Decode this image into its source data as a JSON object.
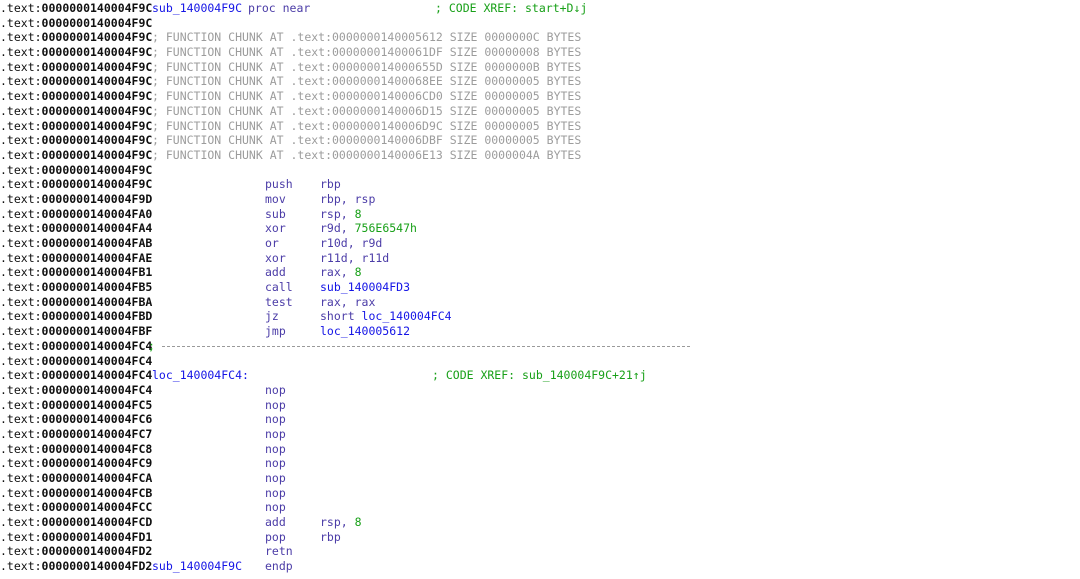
{
  "app": {
    "name": "IDA Pro disassembly listing",
    "view": "IDA View-A",
    "segment": "text",
    "background_color": "#ffffff"
  },
  "colors": {
    "address": "#101010",
    "name": "#1414e6",
    "keyword": "#4b3ca7",
    "mnemonic": "#4b3ca7",
    "operand_register": "#4b3ca7",
    "operand_number": "#18a018",
    "branch_target": "#1414e6",
    "comment": "#18a018",
    "comment_dim": "#9c9c9c",
    "separator": "#9a9a9a"
  },
  "function": {
    "name": "sub_140004F9C",
    "proc_keyword": "proc near",
    "endp_keyword": "endp",
    "start_address": "0000000140004F9C",
    "end_address": "0000000140004FD2",
    "xref_comment": "; CODE XREF: start+D↓j"
  },
  "chunks": [
    {
      "prefix": "; FUNCTION CHUNK AT",
      "seg": ".text:",
      "address": "0000000140005612",
      "size_label": "SIZE",
      "size": "0000000C",
      "unit": "BYTES"
    },
    {
      "prefix": "; FUNCTION CHUNK AT",
      "seg": ".text:",
      "address": "00000001400061DF",
      "size_label": "SIZE",
      "size": "00000008",
      "unit": "BYTES"
    },
    {
      "prefix": "; FUNCTION CHUNK AT",
      "seg": ".text:",
      "address": "000000014000655D",
      "size_label": "SIZE",
      "size": "0000000B",
      "unit": "BYTES"
    },
    {
      "prefix": "; FUNCTION CHUNK AT",
      "seg": ".text:",
      "address": "00000001400068EE",
      "size_label": "SIZE",
      "size": "00000005",
      "unit": "BYTES"
    },
    {
      "prefix": "; FUNCTION CHUNK AT",
      "seg": ".text:",
      "address": "0000000140006CD0",
      "size_label": "SIZE",
      "size": "00000005",
      "unit": "BYTES"
    },
    {
      "prefix": "; FUNCTION CHUNK AT",
      "seg": ".text:",
      "address": "0000000140006D15",
      "size_label": "SIZE",
      "size": "00000005",
      "unit": "BYTES"
    },
    {
      "prefix": "; FUNCTION CHUNK AT",
      "seg": ".text:",
      "address": "0000000140006D9C",
      "size_label": "SIZE",
      "size": "00000005",
      "unit": "BYTES"
    },
    {
      "prefix": "; FUNCTION CHUNK AT",
      "seg": ".text:",
      "address": "0000000140006DBF",
      "size_label": "SIZE",
      "size": "00000005",
      "unit": "BYTES"
    },
    {
      "prefix": "; FUNCTION CHUNK AT",
      "seg": ".text:",
      "address": "0000000140006E13",
      "size_label": "SIZE",
      "size": "0000004A",
      "unit": "BYTES"
    }
  ],
  "label": {
    "name": "loc_140004FC4:",
    "address": "0000000140004FC4",
    "xref_comment": "; CODE XREF: sub_140004F9C+21↑j"
  },
  "separator": {
    "semicolon": ";",
    "address": "0000000140004FC4"
  },
  "segment_prefix": ".text:",
  "lines": [
    {
      "kind": "proc",
      "addr": "0000000140004F9C"
    },
    {
      "kind": "blank",
      "addr": "0000000140004F9C"
    },
    {
      "kind": "chunk",
      "addr": "0000000140004F9C",
      "chunk": 0
    },
    {
      "kind": "chunk",
      "addr": "0000000140004F9C",
      "chunk": 1
    },
    {
      "kind": "chunk",
      "addr": "0000000140004F9C",
      "chunk": 2
    },
    {
      "kind": "chunk",
      "addr": "0000000140004F9C",
      "chunk": 3
    },
    {
      "kind": "chunk",
      "addr": "0000000140004F9C",
      "chunk": 4
    },
    {
      "kind": "chunk",
      "addr": "0000000140004F9C",
      "chunk": 5
    },
    {
      "kind": "chunk",
      "addr": "0000000140004F9C",
      "chunk": 6
    },
    {
      "kind": "chunk",
      "addr": "0000000140004F9C",
      "chunk": 7
    },
    {
      "kind": "chunk",
      "addr": "0000000140004F9C",
      "chunk": 8
    },
    {
      "kind": "blank",
      "addr": "0000000140004F9C"
    },
    {
      "kind": "insn",
      "addr": "0000000140004F9C",
      "mnemonic": "push",
      "operands": [
        {
          "t": "reg",
          "v": "rbp"
        }
      ]
    },
    {
      "kind": "insn",
      "addr": "0000000140004F9D",
      "mnemonic": "mov",
      "operands": [
        {
          "t": "reg",
          "v": "rbp, rsp"
        }
      ]
    },
    {
      "kind": "insn",
      "addr": "0000000140004FA0",
      "mnemonic": "sub",
      "operands": [
        {
          "t": "reg",
          "v": "rsp, "
        },
        {
          "t": "num",
          "v": "8"
        }
      ]
    },
    {
      "kind": "insn",
      "addr": "0000000140004FA4",
      "mnemonic": "xor",
      "operands": [
        {
          "t": "reg",
          "v": "r9d, "
        },
        {
          "t": "num",
          "v": "756E6547h"
        }
      ]
    },
    {
      "kind": "insn",
      "addr": "0000000140004FAB",
      "mnemonic": "or",
      "operands": [
        {
          "t": "reg",
          "v": "r10d, r9d"
        }
      ]
    },
    {
      "kind": "insn",
      "addr": "0000000140004FAE",
      "mnemonic": "xor",
      "operands": [
        {
          "t": "reg",
          "v": "r11d, r11d"
        }
      ]
    },
    {
      "kind": "insn",
      "addr": "0000000140004FB1",
      "mnemonic": "add",
      "operands": [
        {
          "t": "reg",
          "v": "rax, "
        },
        {
          "t": "num",
          "v": "8"
        }
      ]
    },
    {
      "kind": "insn",
      "addr": "0000000140004FB5",
      "mnemonic": "call",
      "operands": [
        {
          "t": "target",
          "v": "sub_140004FD3"
        }
      ]
    },
    {
      "kind": "insn",
      "addr": "0000000140004FBA",
      "mnemonic": "test",
      "operands": [
        {
          "t": "reg",
          "v": "rax, rax"
        }
      ]
    },
    {
      "kind": "insn",
      "addr": "0000000140004FBD",
      "mnemonic": "jz",
      "operands": [
        {
          "t": "reg",
          "v": "short "
        },
        {
          "t": "target",
          "v": "loc_140004FC4"
        }
      ]
    },
    {
      "kind": "insn",
      "addr": "0000000140004FBF",
      "mnemonic": "jmp",
      "operands": [
        {
          "t": "target",
          "v": "loc_140005612"
        }
      ]
    },
    {
      "kind": "sep",
      "addr": "0000000140004FC4"
    },
    {
      "kind": "blank",
      "addr": "0000000140004FC4"
    },
    {
      "kind": "label",
      "addr": "0000000140004FC4"
    },
    {
      "kind": "insn",
      "addr": "0000000140004FC4",
      "mnemonic": "nop",
      "operands": []
    },
    {
      "kind": "insn",
      "addr": "0000000140004FC5",
      "mnemonic": "nop",
      "operands": []
    },
    {
      "kind": "insn",
      "addr": "0000000140004FC6",
      "mnemonic": "nop",
      "operands": []
    },
    {
      "kind": "insn",
      "addr": "0000000140004FC7",
      "mnemonic": "nop",
      "operands": []
    },
    {
      "kind": "insn",
      "addr": "0000000140004FC8",
      "mnemonic": "nop",
      "operands": []
    },
    {
      "kind": "insn",
      "addr": "0000000140004FC9",
      "mnemonic": "nop",
      "operands": []
    },
    {
      "kind": "insn",
      "addr": "0000000140004FCA",
      "mnemonic": "nop",
      "operands": []
    },
    {
      "kind": "insn",
      "addr": "0000000140004FCB",
      "mnemonic": "nop",
      "operands": []
    },
    {
      "kind": "insn",
      "addr": "0000000140004FCC",
      "mnemonic": "nop",
      "operands": []
    },
    {
      "kind": "insn",
      "addr": "0000000140004FCD",
      "mnemonic": "add",
      "operands": [
        {
          "t": "reg",
          "v": "rsp, "
        },
        {
          "t": "num",
          "v": "8"
        }
      ]
    },
    {
      "kind": "insn",
      "addr": "0000000140004FD1",
      "mnemonic": "pop",
      "operands": [
        {
          "t": "reg",
          "v": "rbp"
        }
      ]
    },
    {
      "kind": "insn",
      "addr": "0000000140004FD2",
      "mnemonic": "retn",
      "operands": []
    },
    {
      "kind": "endp",
      "addr": "0000000140004FD2"
    }
  ]
}
